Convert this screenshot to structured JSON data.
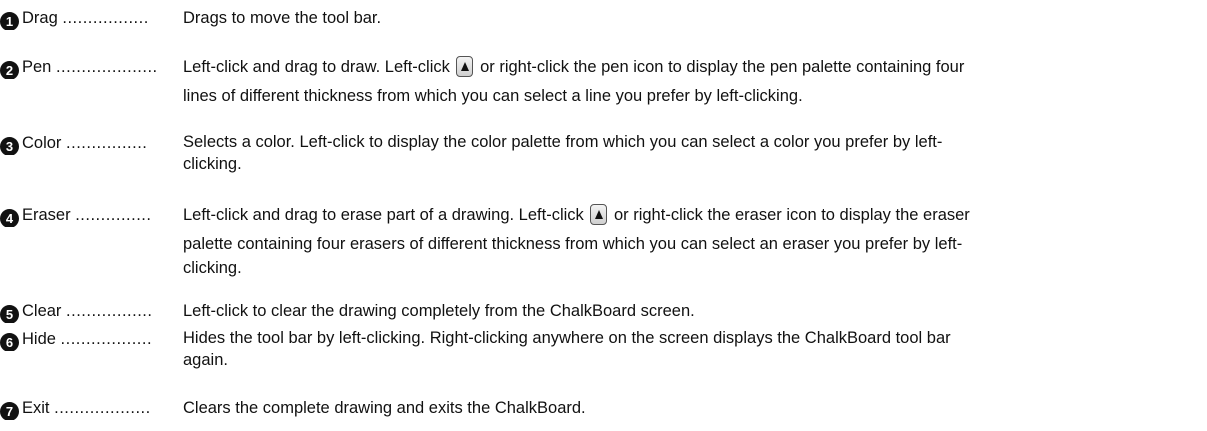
{
  "entries": [
    {
      "number": "1",
      "term": "Drag",
      "dots": ".................",
      "definition": [
        "Drags to move the tool bar."
      ]
    },
    {
      "number": "2",
      "term": "Pen",
      "dots": "....................",
      "definition_before_icon": "Left-click and drag to draw. Left-click",
      "icon": "arrow-button-icon",
      "definition_after_icon": "or right-click the pen icon to display the pen palette containing four",
      "definition": [
        "lines of different thickness from which you can select a line you prefer by left-clicking."
      ]
    },
    {
      "number": "3",
      "term": "Color",
      "dots": "................",
      "definition": [
        "Selects a color. Left-click to display the color palette from which you can select a color you prefer by left-",
        "clicking."
      ]
    },
    {
      "number": "4",
      "term": "Eraser",
      "dots": "...............",
      "definition_before_icon": "Left-click and drag to erase part of a drawing. Left-click",
      "icon": "arrow-button-icon",
      "definition_after_icon": "or right-click the eraser icon to display the eraser",
      "definition": [
        "palette containing four erasers of different thickness from which you can select an eraser you prefer by left-",
        "clicking."
      ]
    },
    {
      "number": "5",
      "term": "Clear",
      "dots": ".................",
      "definition": [
        "Left-click to clear the drawing completely from the ChalkBoard screen."
      ]
    },
    {
      "number": "6",
      "term": "Hide",
      "dots": "..................",
      "definition": [
        "Hides the tool bar by left-clicking. Right-clicking anywhere on the screen displays the ChalkBoard tool bar",
        "again."
      ]
    },
    {
      "number": "7",
      "term": "Exit",
      "dots": "...................",
      "definition": [
        "Clears the complete drawing and exits the ChalkBoard."
      ]
    }
  ]
}
